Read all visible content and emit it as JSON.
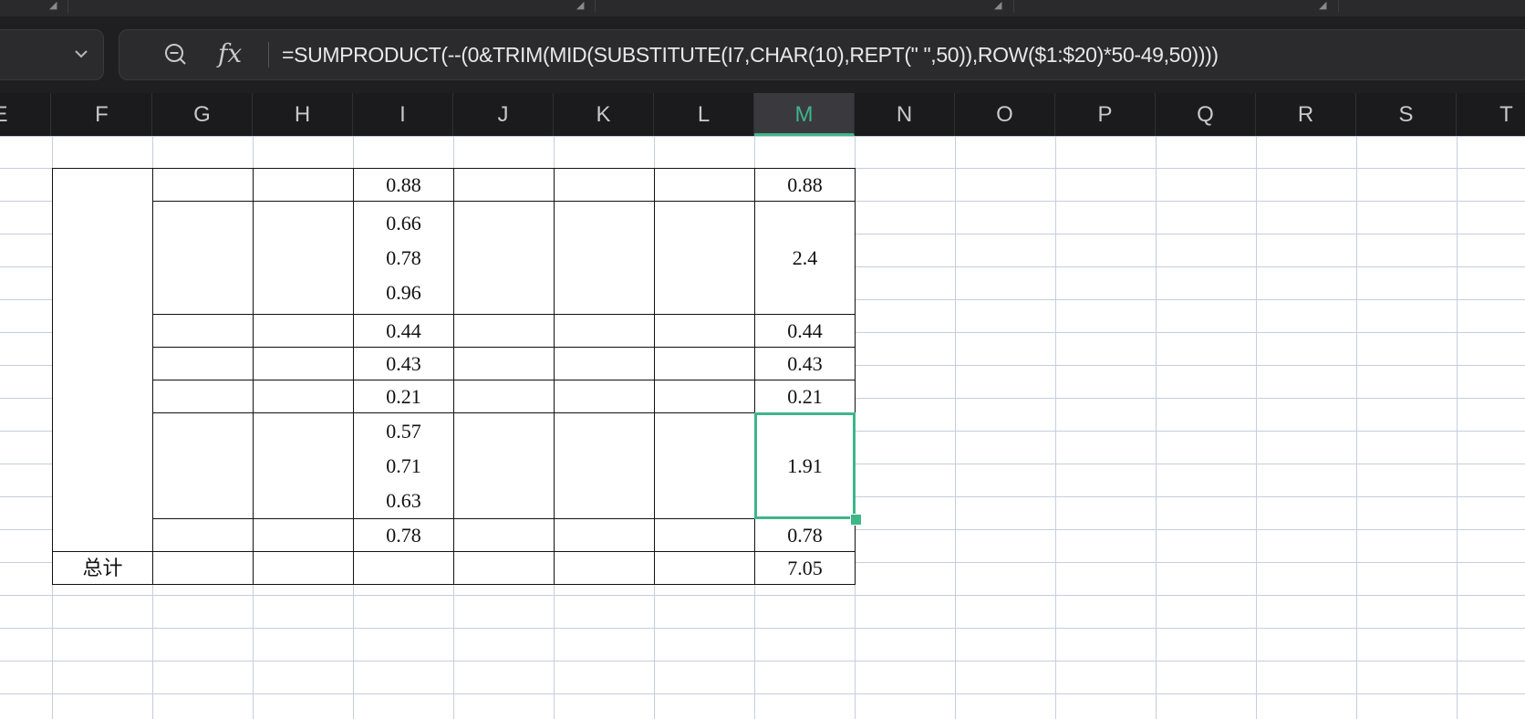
{
  "formula_bar": {
    "name_box": "",
    "formula": "=SUMPRODUCT(--(0&TRIM(MID(SUBSTITUTE(I7,CHAR(10),REPT(\" \",50)),ROW($1:$20)*50-49,50))))",
    "zoom_icon": "zoom-out-icon",
    "fx_label": "fx"
  },
  "columns": [
    "E",
    "F",
    "G",
    "H",
    "I",
    "J",
    "K",
    "L",
    "M",
    "N",
    "O",
    "P",
    "Q",
    "R",
    "S",
    "T"
  ],
  "active_column": "M",
  "table": {
    "rows": [
      {
        "i": [
          "0.88"
        ],
        "m": "0.88"
      },
      {
        "i": [
          "0.66",
          "0.78",
          "0.96"
        ],
        "m": "2.4"
      },
      {
        "i": [
          "0.44"
        ],
        "m": "0.44"
      },
      {
        "i": [
          "0.43"
        ],
        "m": "0.43"
      },
      {
        "i": [
          "0.21"
        ],
        "m": "0.21"
      },
      {
        "i": [
          "0.57",
          "0.71",
          "0.63"
        ],
        "m": "1.91"
      },
      {
        "i": [
          "0.78"
        ],
        "m": "0.78"
      }
    ],
    "total_label": "总计",
    "total_value": "7.05"
  },
  "colors": {
    "accent": "#3fb58a",
    "header_bg": "#1b1b1d",
    "gridline": "#c7cde0"
  }
}
